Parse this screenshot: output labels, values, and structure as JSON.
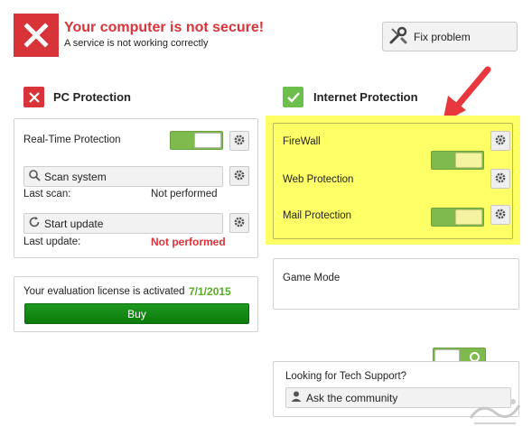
{
  "header": {
    "title": "Your computer is not secure!",
    "subtitle": "A service is not working correctly",
    "fix_button": "Fix problem"
  },
  "pc_protection": {
    "title": "PC Protection",
    "realtime_label": "Real-Time Protection",
    "realtime_on": true,
    "scan_button": "Scan system",
    "last_scan_label": "Last scan:",
    "last_scan_value": "Not performed",
    "update_button": "Start update",
    "last_update_label": "Last update:",
    "last_update_value": "Not performed"
  },
  "license": {
    "text": "Your evaluation license is activated",
    "date": "7/1/2015",
    "buy_button": "Buy"
  },
  "internet_protection": {
    "title": "Internet Protection",
    "items": [
      {
        "label": "FireWall",
        "on": true
      },
      {
        "label": "Web Protection",
        "on": true
      },
      {
        "label": "Mail Protection",
        "on": true
      }
    ]
  },
  "game_mode": {
    "label": "Game Mode",
    "on": false
  },
  "support": {
    "label": "Looking for Tech Support?",
    "button": "Ask the community"
  },
  "colors": {
    "danger": "#d9333a",
    "success": "#6cbf4a",
    "toggle_green": "#7fba4f",
    "highlight": "#ffff66",
    "buy_green": "#0b7a0b"
  },
  "icons": [
    "close-icon",
    "wrench-icon",
    "check-icon",
    "gear-icon",
    "magnifier-icon",
    "refresh-icon",
    "user-icon",
    "arrow-annotation"
  ]
}
